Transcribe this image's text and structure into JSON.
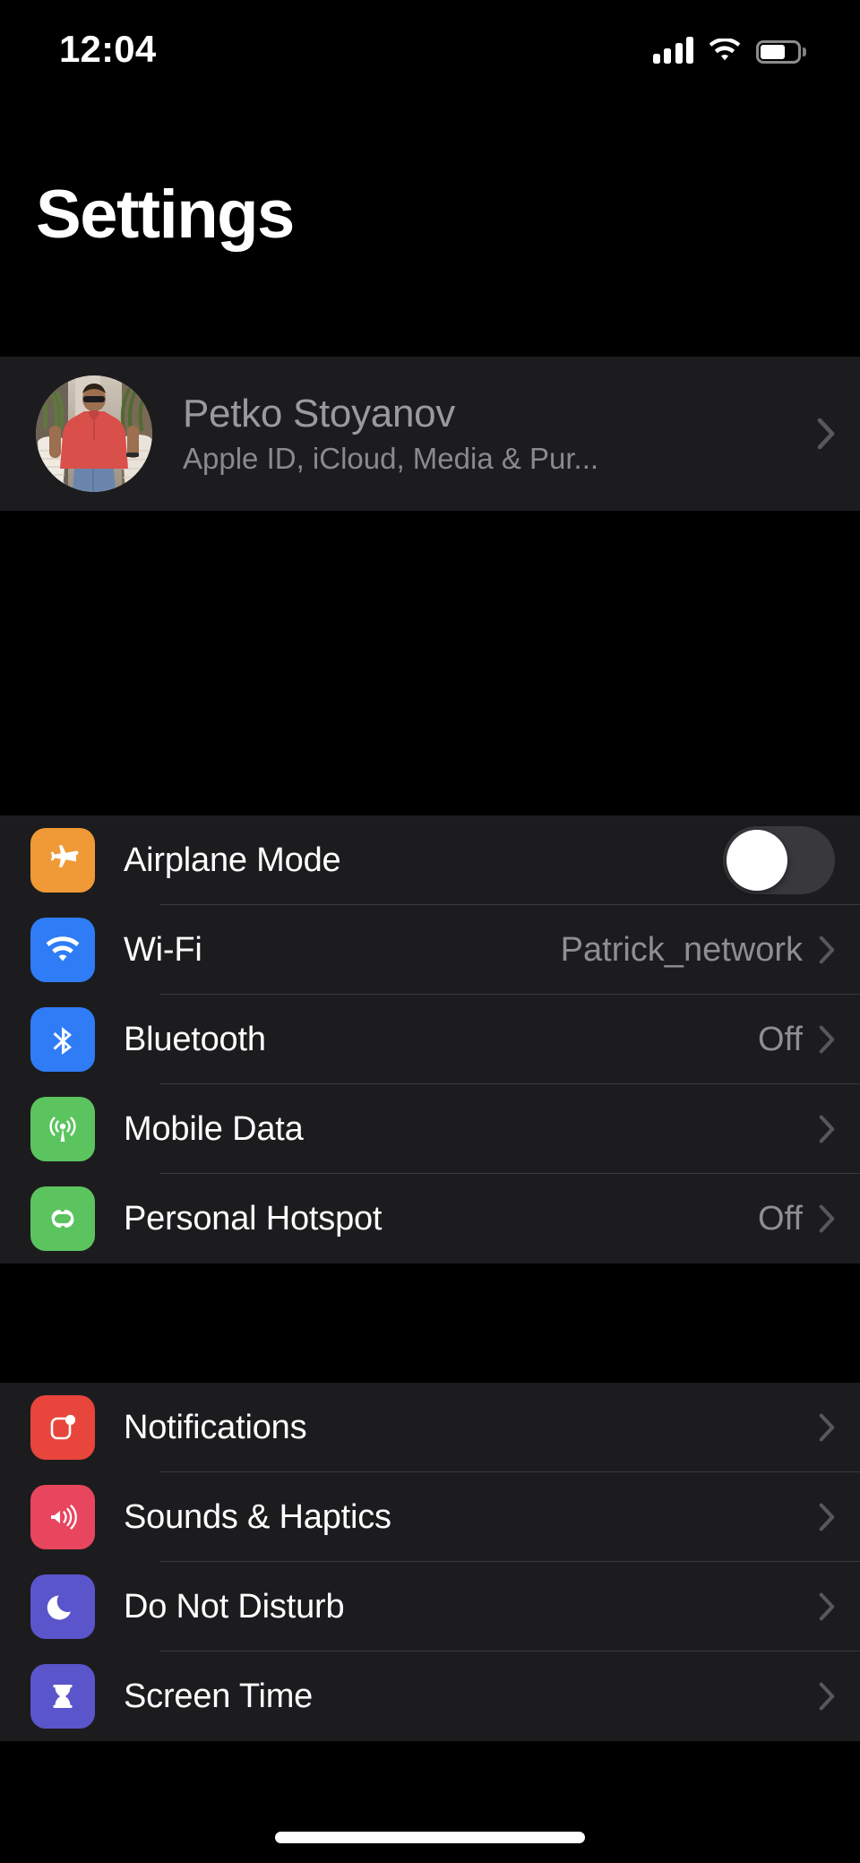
{
  "status_bar": {
    "time": "12:04",
    "signal_icon": "cellular-signal-icon",
    "signal_bars_filled": 4,
    "wifi_icon": "wifi-icon",
    "battery_icon": "battery-icon",
    "battery_level_percent": 75
  },
  "header": {
    "title": "Settings"
  },
  "profile": {
    "name": "Petko Stoyanov",
    "subtitle": "Apple ID, iCloud, Media & Pur...",
    "avatar_icon": "user-avatar-photo",
    "chevron_icon": "chevron-right-icon"
  },
  "colors": {
    "page_background": "#000000",
    "section_background": "#1C1C1E",
    "separator": "#3A3A3C",
    "label": "#FFFFFF",
    "secondary_label": "#8E8E93",
    "toggle_off_track": "#39393D",
    "toggle_knob": "#FFFFFF",
    "airplane_orange": "#F09A37",
    "wifi_blue": "#2F7CF6",
    "bluetooth_blue": "#2F7CF6",
    "mobile_green": "#5CC45F",
    "hotspot_green": "#5CC45F",
    "notifications_red": "#E8453C",
    "sounds_pink": "#E8465E",
    "dnd_purple": "#5A55CA",
    "screentime_purple": "#5A55CA"
  },
  "groups": [
    {
      "name": "connectivity",
      "rows": [
        {
          "label": "Airplane Mode",
          "icon": "airplane-icon",
          "icon_color": "#F09A37",
          "control": "toggle",
          "toggle_state": "off",
          "value": "",
          "chevron": false
        },
        {
          "label": "Wi-Fi",
          "icon": "wifi-icon",
          "icon_color": "#2F7CF6",
          "control": "disclosure",
          "value": "Patrick_network",
          "chevron": true
        },
        {
          "label": "Bluetooth",
          "icon": "bluetooth-icon",
          "icon_color": "#2F7CF6",
          "control": "disclosure",
          "value": "Off",
          "chevron": true
        },
        {
          "label": "Mobile Data",
          "icon": "cellular-tower-icon",
          "icon_color": "#5CC45F",
          "control": "disclosure",
          "value": "",
          "chevron": true
        },
        {
          "label": "Personal Hotspot",
          "icon": "hotspot-link-icon",
          "icon_color": "#5CC45F",
          "control": "disclosure",
          "value": "Off",
          "chevron": true
        }
      ]
    },
    {
      "name": "alerts",
      "rows": [
        {
          "label": "Notifications",
          "icon": "notifications-badge-icon",
          "icon_color": "#E8453C",
          "control": "disclosure",
          "value": "",
          "chevron": true
        },
        {
          "label": "Sounds & Haptics",
          "icon": "speaker-waves-icon",
          "icon_color": "#E8465E",
          "control": "disclosure",
          "value": "",
          "chevron": true
        },
        {
          "label": "Do Not Disturb",
          "icon": "crescent-moon-icon",
          "icon_color": "#5A55CA",
          "control": "disclosure",
          "value": "",
          "chevron": true
        },
        {
          "label": "Screen Time",
          "icon": "hourglass-icon",
          "icon_color": "#5A55CA",
          "control": "disclosure",
          "value": "",
          "chevron": true
        }
      ]
    }
  ],
  "home_indicator": {
    "icon": "home-indicator-bar"
  }
}
